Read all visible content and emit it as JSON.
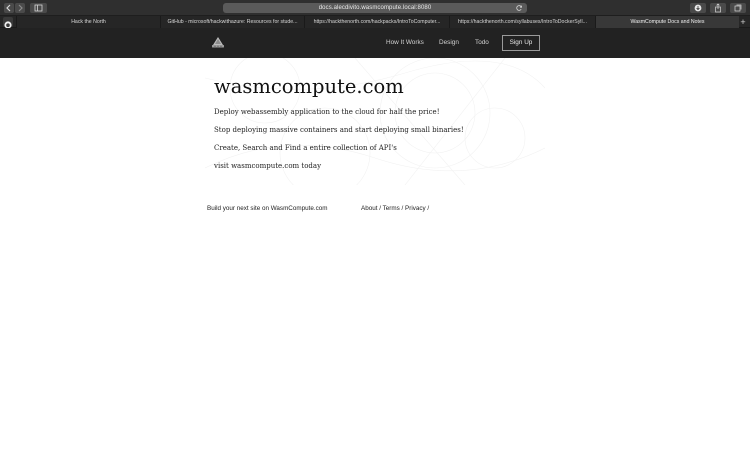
{
  "browser": {
    "address": "docs.alecdivito.wasmcompute.local:8080",
    "tabs": [
      {
        "label": "Hack the North",
        "active": false
      },
      {
        "label": "GitHub - microsoft/hackwithazure: Resources for stude...",
        "active": false
      },
      {
        "label": "https://hackthenorth.com/hackpacks/IntroToComputer...",
        "active": false
      },
      {
        "label": "https://hackthenorth.com/syllabuses/IntroToDockerSyll...",
        "active": false
      },
      {
        "label": "WasmCompute Docs and Notes",
        "active": true
      }
    ],
    "new_tab_symbol": "+"
  },
  "header": {
    "logo_icon": "wasm-logo-icon",
    "nav": [
      {
        "label": "How It Works"
      },
      {
        "label": "Design"
      },
      {
        "label": "Todo"
      }
    ],
    "signup_label": "Sign Up"
  },
  "hero": {
    "title": "wasmcompute.com",
    "lines": [
      "Deploy webassembly application to the cloud for half the price!",
      "Stop deploying massive containers and start deploying small binaries!",
      "Create, Search and Find a entire collection of API's",
      "visit wasmcompute.com today"
    ]
  },
  "footer": {
    "tagline": "Build your next site on WasmCompute.com",
    "links": [
      {
        "label": "About"
      },
      {
        "label": "Terms"
      },
      {
        "label": "Privacy"
      }
    ],
    "separator": " / "
  },
  "colors": {
    "chrome": "#2f2f2f",
    "site_header": "#222222",
    "page_bg": "#ffffff"
  }
}
